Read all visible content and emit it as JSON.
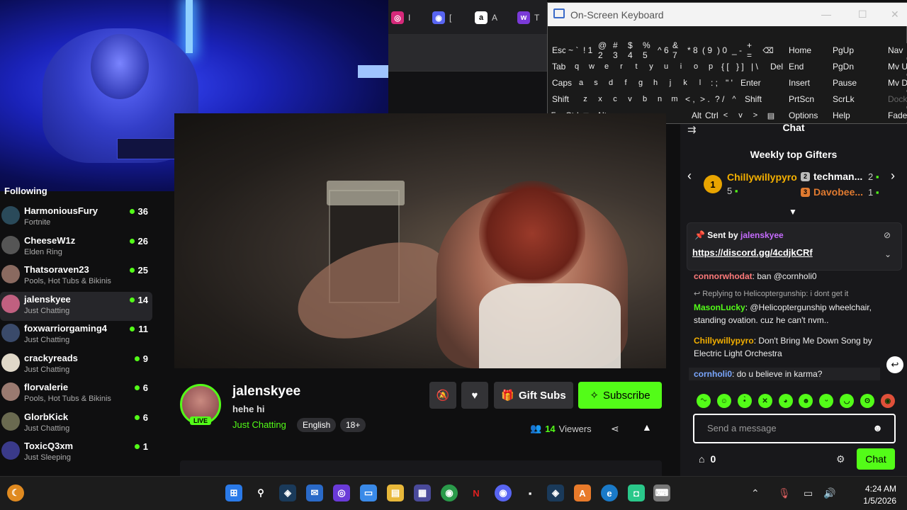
{
  "osk": {
    "title": "On-Screen Keyboard",
    "rows": [
      [
        "Esc",
        "~ `",
        "! 1",
        "@ 2",
        "# 3",
        "$ 4",
        "% 5",
        "^ 6",
        "& 7",
        "* 8",
        "( 9",
        ") 0",
        "_ -",
        "+ =",
        "⌫"
      ],
      [
        "Tab",
        "q",
        "w",
        "e",
        "r",
        "t",
        "y",
        "u",
        "i",
        "o",
        "p",
        "{ [",
        "} ]",
        "| \\",
        "Del"
      ],
      [
        "Caps",
        "a",
        "s",
        "d",
        "f",
        "g",
        "h",
        "j",
        "k",
        "l",
        ": ;",
        "\" '",
        "Enter"
      ],
      [
        "Shift",
        "z",
        "x",
        "c",
        "v",
        "b",
        "n",
        "m",
        "< ,",
        "> .",
        "? /",
        "^",
        "Shift"
      ],
      [
        "Fn",
        "Ctrl",
        "⊞",
        "Alt",
        "",
        "Alt",
        "Ctrl",
        "<",
        "v",
        ">",
        "▤"
      ]
    ],
    "nav_keys": [
      [
        "Home",
        "PgUp",
        "Nav"
      ],
      [
        "End",
        "PgDn",
        "Mv Up"
      ],
      [
        "Insert",
        "Pause",
        "Mv Dn"
      ],
      [
        "PrtScn",
        "ScrLk",
        "Dock"
      ],
      [
        "Options",
        "Help",
        "Fade"
      ]
    ]
  },
  "sidebar": {
    "heading": "Following",
    "channels": [
      {
        "name": "HarmoniousFury",
        "category": "Fortnite",
        "viewers": "36",
        "avatar": "#2a4a5a"
      },
      {
        "name": "CheeseW1z",
        "category": "Elden Ring",
        "viewers": "26",
        "avatar": "#555"
      },
      {
        "name": "Thatsoraven23",
        "category": "Pools, Hot Tubs & Bikinis",
        "viewers": "25",
        "avatar": "#8a6a60"
      },
      {
        "name": "jalenskyee",
        "category": "Just Chatting",
        "viewers": "14",
        "avatar": "#c06080"
      },
      {
        "name": "foxwarriorgaming4",
        "category": "Just Chatting",
        "viewers": "11",
        "avatar": "#3a4a6a"
      },
      {
        "name": "crackyreads",
        "category": "Just Chatting",
        "viewers": "9",
        "avatar": "#e0d8c8"
      },
      {
        "name": "florvalerie",
        "category": "Pools, Hot Tubs & Bikinis",
        "viewers": "6",
        "avatar": "#9a7a70"
      },
      {
        "name": "GlorbKick",
        "category": "Just Chatting",
        "viewers": "6",
        "avatar": "#6a6a50"
      },
      {
        "name": "ToxicQ3xm",
        "category": "Just Sleeping",
        "viewers": "1",
        "avatar": "#3a3a8a"
      }
    ]
  },
  "stream": {
    "streamer": "jalenskyee",
    "live_badge": "LIVE",
    "title": "hehe hi",
    "category": "Just Chatting",
    "tags": [
      "English",
      "18+"
    ],
    "gift_label": "Gift Subs",
    "subscribe_label": "Subscribe",
    "viewers_count": "14",
    "viewers_label": "Viewers"
  },
  "chat": {
    "header": "Chat",
    "gifters_title": "Weekly top Gifters",
    "top_gifter": {
      "rank": "1",
      "name": "Chillywillypyro",
      "count": "5"
    },
    "other_gifters": [
      {
        "rank": "2",
        "name": "techman...",
        "count": "2",
        "color": "#bbbbbb"
      },
      {
        "rank": "3",
        "name": "Davobee...",
        "count": "1",
        "color": "#e07a30"
      }
    ],
    "pinned": {
      "sent_by": "Sent by",
      "user": "jalenskyee",
      "link": "https://discord.gg/4cdjkCRf"
    },
    "messages": [
      {
        "user": "connorwhodat",
        "color": "#ff7a7a",
        "text": "ban @cornholi0"
      },
      {
        "reply": "Replying to Helicoptergunship: i dont get it"
      },
      {
        "user": "MasonLucky",
        "color": "#53fc18",
        "text": "@Helicoptergunship wheelchair, standing ovation. cuz he can't nvm.."
      },
      {
        "user": "Chillywillypyro",
        "color": "#f4b000",
        "text": "Don't Bring Me Down Song by Electric Light Orchestra"
      },
      {
        "user": "cornholi0",
        "color": "#7aa7ff",
        "text": "do u believe in karma?"
      }
    ],
    "input_placeholder": "Send a message",
    "points": "0",
    "send_label": "Chat"
  },
  "bookmarks": [
    "I",
    "[",
    "A",
    "T"
  ],
  "taskbar": {
    "time": "4:24 AM",
    "date": "1/5/2026"
  },
  "colors": {
    "accent": "#53fc18",
    "bg": "#0f0f10",
    "panel": "#18181b"
  }
}
